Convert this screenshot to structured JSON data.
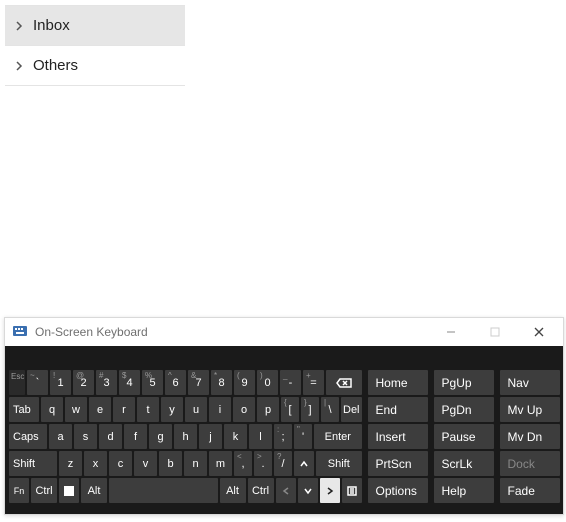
{
  "folders": {
    "items": [
      {
        "label": "Inbox",
        "selected": true
      },
      {
        "label": "Others",
        "selected": false
      }
    ]
  },
  "osk": {
    "title": "On-Screen Keyboard",
    "rows": {
      "r1": {
        "esc": "Esc",
        "keys": [
          {
            "main": "`",
            "sup": "~"
          },
          {
            "main": "1",
            "sup": "!"
          },
          {
            "main": "2",
            "sup": "@"
          },
          {
            "main": "3",
            "sup": "#"
          },
          {
            "main": "4",
            "sup": "$"
          },
          {
            "main": "5",
            "sup": "%"
          },
          {
            "main": "6",
            "sup": "^"
          },
          {
            "main": "7",
            "sup": "&"
          },
          {
            "main": "8",
            "sup": "*"
          },
          {
            "main": "9",
            "sup": "("
          },
          {
            "main": "0",
            "sup": ")"
          },
          {
            "main": "-",
            "sup": "_"
          },
          {
            "main": "=",
            "sup": "+"
          }
        ]
      },
      "r2": {
        "tab": "Tab",
        "keys": [
          "q",
          "w",
          "e",
          "r",
          "t",
          "y",
          "u",
          "i",
          "o",
          "p"
        ],
        "brackets": [
          {
            "main": "[",
            "sup": "{"
          },
          {
            "main": "]",
            "sup": "}"
          },
          {
            "main": "\\",
            "sup": "|"
          }
        ],
        "del": "Del"
      },
      "r3": {
        "caps": "Caps",
        "keys": [
          "a",
          "s",
          "d",
          "f",
          "g",
          "h",
          "j",
          "k",
          "l"
        ],
        "punct": [
          {
            "main": ";",
            "sup": ":"
          },
          {
            "main": "'",
            "sup": "\""
          }
        ],
        "enter": "Enter"
      },
      "r4": {
        "lshift": "Shift",
        "keys": [
          "z",
          "x",
          "c",
          "v",
          "b",
          "n",
          "m"
        ],
        "punct": [
          {
            "main": ",",
            "sup": "<"
          },
          {
            "main": ".",
            "sup": ">"
          },
          {
            "main": "/",
            "sup": "?"
          }
        ],
        "rshift": "Shift"
      },
      "r5": {
        "fn": "Fn",
        "lctrl": "Ctrl",
        "lalt": "Alt",
        "ralt": "Alt",
        "rctrl": "Ctrl"
      }
    },
    "side": {
      "col1": [
        "Home",
        "End",
        "Insert",
        "PrtScn",
        "Options"
      ],
      "col2": [
        "PgUp",
        "PgDn",
        "Pause",
        "ScrLk",
        "Help"
      ],
      "col3": [
        {
          "label": "Nav",
          "dim": false
        },
        {
          "label": "Mv Up",
          "dim": false
        },
        {
          "label": "Mv Dn",
          "dim": false
        },
        {
          "label": "Dock",
          "dim": true
        },
        {
          "label": "Fade",
          "dim": false
        }
      ]
    }
  }
}
